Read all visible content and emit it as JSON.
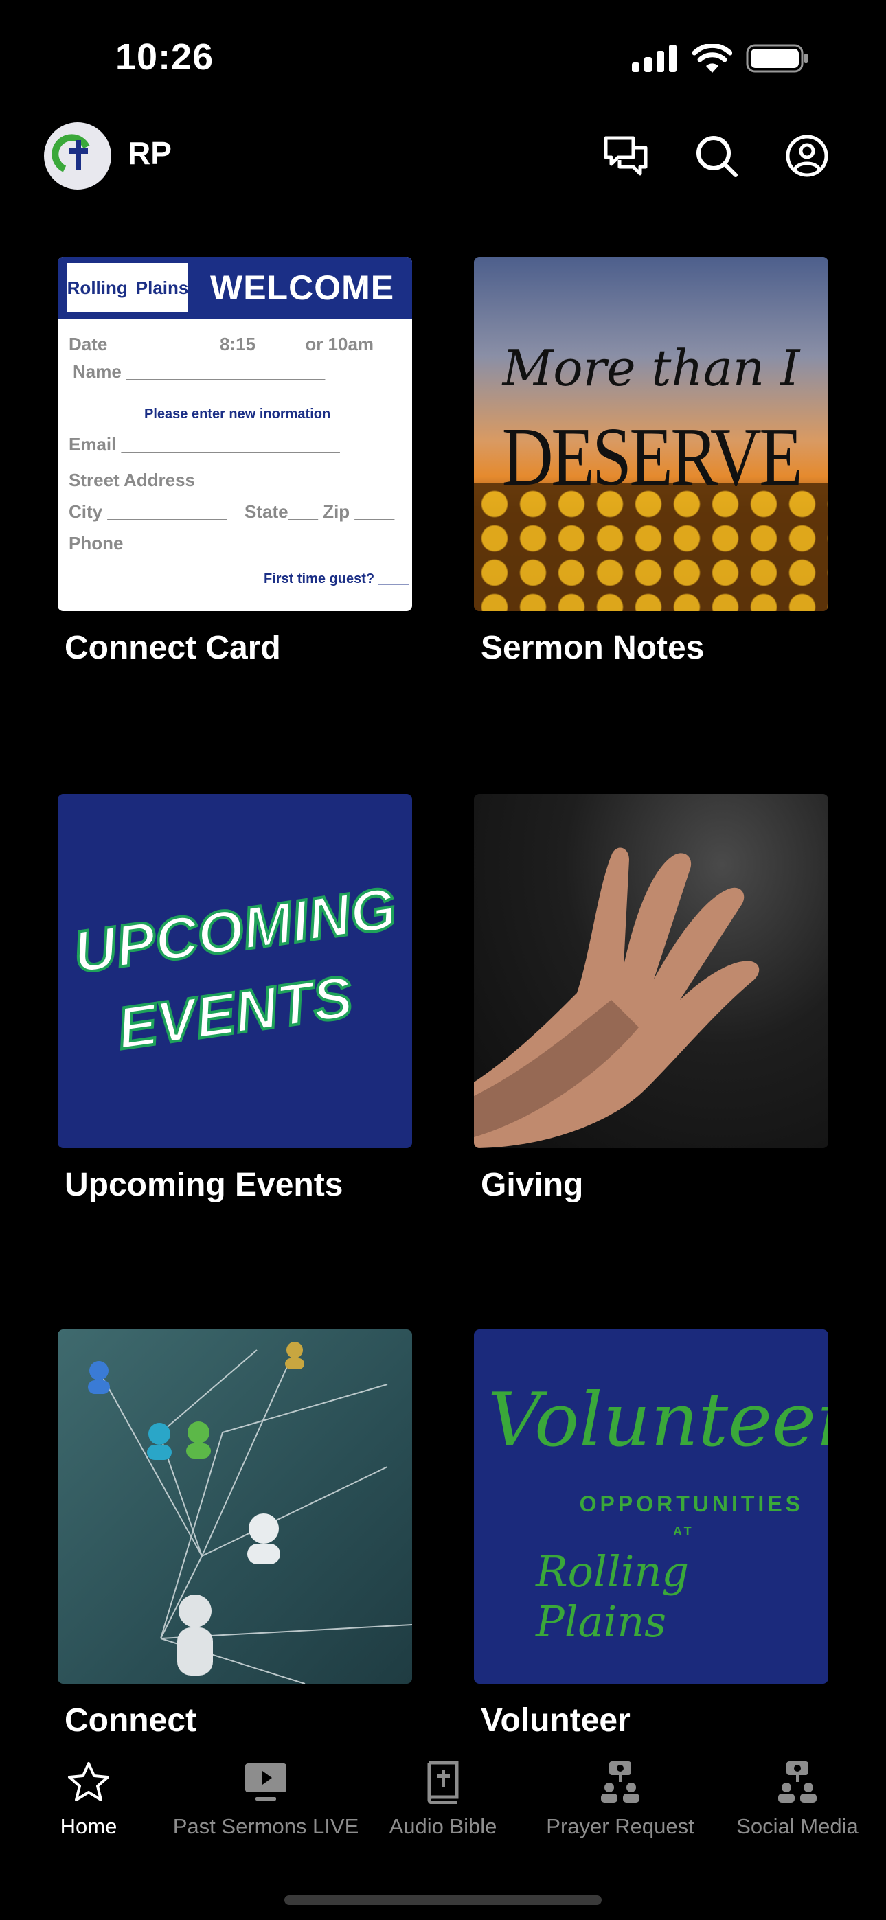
{
  "status_bar": {
    "time": "10:26"
  },
  "header": {
    "title": "RP",
    "icons": [
      "chat-icon",
      "search-icon",
      "profile-icon"
    ]
  },
  "tiles": [
    {
      "label": "Connect Card",
      "card": {
        "logo_left": "Rolling",
        "logo_right": "Plains",
        "heading": "WELCOME",
        "line_date": "Date _________",
        "line_time": "8:15 ____ or 10am ____",
        "line_name": "Name ____________________",
        "prompt": "Please enter new inormation",
        "line_email": "Email ______________________",
        "line_street": "Street Address _______________",
        "line_city": "City ____________",
        "line_state": "State___ Zip ____",
        "line_phone": "Phone ____________",
        "first_time": "First time guest? ____"
      }
    },
    {
      "label": "Sermon Notes",
      "art_top": "More than I",
      "art_bottom": "DESERVE"
    },
    {
      "label": "Upcoming Events",
      "art_line1": "UPCOMING",
      "art_line2": "EVENTS"
    },
    {
      "label": "Giving"
    },
    {
      "label": "Connect"
    },
    {
      "label": "Volunteer",
      "art_title": "Volunteer",
      "art_sub": "OPPORTUNITIES",
      "art_at": "AT",
      "art_place": "Rolling Plains"
    }
  ],
  "tabbar": [
    {
      "label": "Home",
      "icon": "star-icon",
      "active": true
    },
    {
      "label": "Past Sermons LIVE",
      "icon": "tv-icon",
      "active": false
    },
    {
      "label": "Audio Bible",
      "icon": "bible-icon",
      "active": false
    },
    {
      "label": "Prayer Request",
      "icon": "people-icon",
      "active": false
    },
    {
      "label": "Social Media",
      "icon": "people-icon",
      "active": false
    }
  ],
  "colors": {
    "background": "#000000",
    "brand_blue": "#1b2f86",
    "volunteer_green": "#3aa83a",
    "inactive_tab": "#8d8d8d"
  }
}
